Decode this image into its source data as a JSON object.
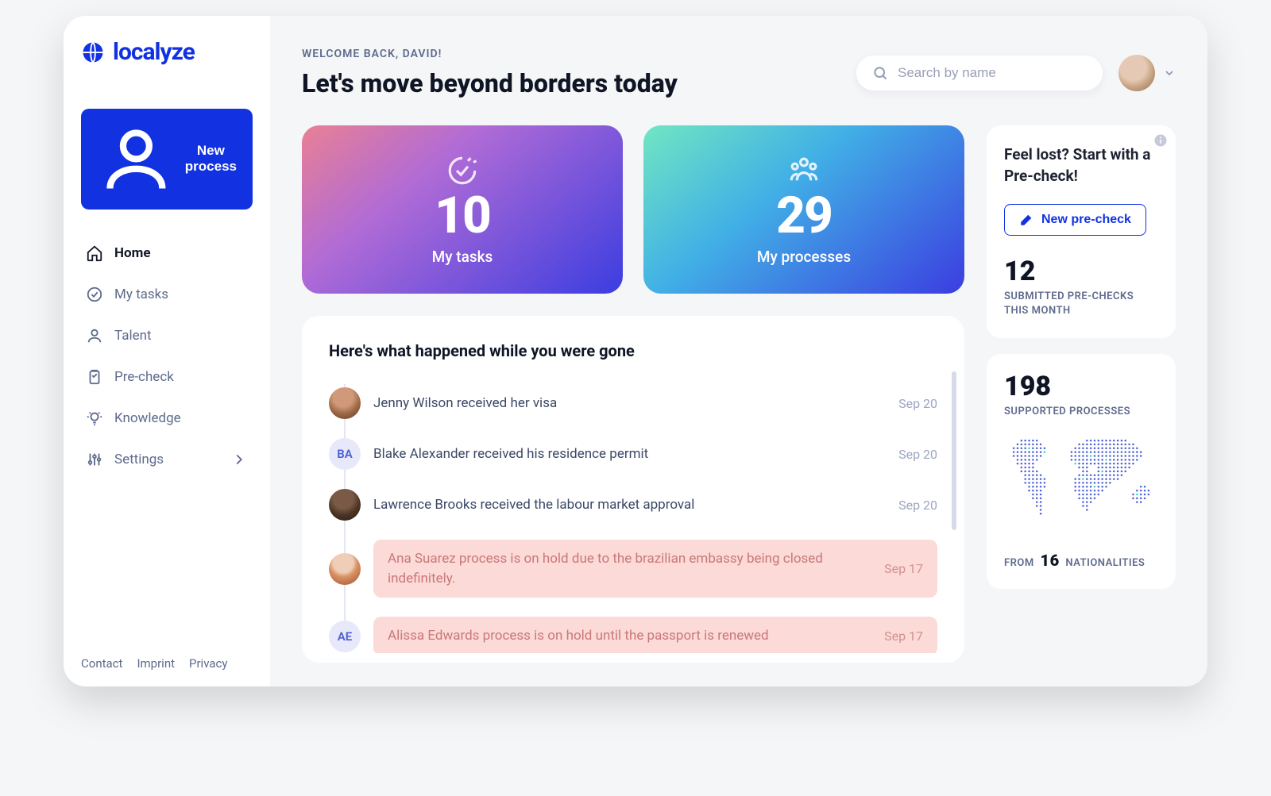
{
  "brand": "localyze",
  "sidebar": {
    "new_process": "New process",
    "items": [
      {
        "label": "Home",
        "icon": "home",
        "active": true
      },
      {
        "label": "My tasks",
        "icon": "check-circle"
      },
      {
        "label": "Talent",
        "icon": "user"
      },
      {
        "label": "Pre-check",
        "icon": "clipboard"
      },
      {
        "label": "Knowledge",
        "icon": "lightbulb"
      },
      {
        "label": "Settings",
        "icon": "sliders",
        "chevron": true
      }
    ],
    "footer": [
      "Contact",
      "Imprint",
      "Privacy"
    ]
  },
  "header": {
    "welcome": "WELCOME BACK, DAVID!",
    "headline": "Let's move beyond borders today",
    "search_placeholder": "Search by name"
  },
  "stat_cards": [
    {
      "value": "10",
      "label": "My tasks",
      "variant": "tasks"
    },
    {
      "value": "29",
      "label": "My processes",
      "variant": "processes"
    }
  ],
  "activity": {
    "title": "Here's what happened while you were gone",
    "items": [
      {
        "avatar_type": "photo",
        "avatar_class": "jenny",
        "initials": "",
        "text": "Jenny Wilson received her visa",
        "date": "Sep 20",
        "flagged": false
      },
      {
        "avatar_type": "initials",
        "avatar_class": "",
        "initials": "BA",
        "text": "Blake Alexander received his residence permit",
        "date": "Sep 20",
        "flagged": false
      },
      {
        "avatar_type": "photo",
        "avatar_class": "lawrence",
        "initials": "",
        "text": "Lawrence Brooks received the labour market approval",
        "date": "Sep 20",
        "flagged": false
      },
      {
        "avatar_type": "photo",
        "avatar_class": "ana",
        "initials": "",
        "text": "Ana Suarez process is on hold due to the brazilian embassy being closed indefinitely.",
        "date": "Sep 17",
        "flagged": true
      },
      {
        "avatar_type": "initials",
        "avatar_class": "",
        "initials": "AE",
        "text": "Alissa Edwards process is on hold until the passport is renewed",
        "date": "Sep 17",
        "flagged": true
      }
    ]
  },
  "precheck_card": {
    "title": "Feel lost? Start with a Pre-check!",
    "button": "New pre-check",
    "count": "12",
    "caption": "SUBMITTED PRE-CHECKS THIS MONTH"
  },
  "processes_card": {
    "count": "198",
    "caption": "SUPPORTED PROCESSES",
    "nat_prefix": "FROM",
    "nat_count": "16",
    "nat_suffix": "NATIONALITIES"
  }
}
